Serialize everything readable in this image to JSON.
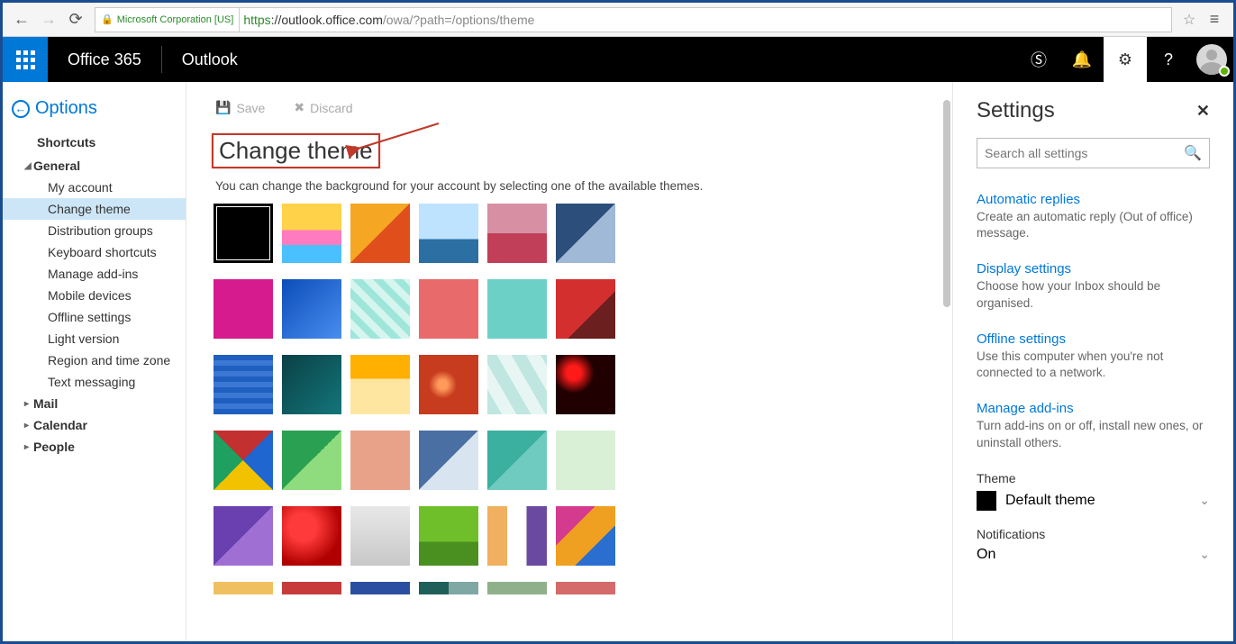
{
  "browser": {
    "cert_name": "Microsoft Corporation [US]",
    "url_proto": "https",
    "url_host": "://outlook.office.com",
    "url_path": "/owa/?path=/options/theme"
  },
  "suite": {
    "brand": "Office 365",
    "app": "Outlook"
  },
  "options": {
    "back_label": "Options",
    "shortcuts_label": "Shortcuts",
    "sections": {
      "general": "General",
      "mail": "Mail",
      "calendar": "Calendar",
      "people": "People"
    },
    "general_items": [
      "My account",
      "Change theme",
      "Distribution groups",
      "Keyboard shortcuts",
      "Manage add-ins",
      "Mobile devices",
      "Offline settings",
      "Light version",
      "Region and time zone",
      "Text messaging"
    ]
  },
  "toolbar": {
    "save": "Save",
    "discard": "Discard"
  },
  "page": {
    "title": "Change theme",
    "desc": "You can change the background for your account by selecting one of the available themes."
  },
  "settings": {
    "title": "Settings",
    "search_placeholder": "Search all settings",
    "items": [
      {
        "title": "Automatic replies",
        "desc": "Create an automatic reply (Out of office) message."
      },
      {
        "title": "Display settings",
        "desc": "Choose how your Inbox should be organised."
      },
      {
        "title": "Offline settings",
        "desc": "Use this computer when you're not connected to a network."
      },
      {
        "title": "Manage add-ins",
        "desc": "Turn add-ins on or off, install new ones, or uninstall others."
      }
    ],
    "theme_label": "Theme",
    "theme_value": "Default theme",
    "notifications_label": "Notifications",
    "notifications_value": "On"
  },
  "themes": [
    {
      "name": "default-black",
      "bg": "#000000",
      "selected": true
    },
    {
      "name": "balloons",
      "bg": "linear-gradient(180deg,#ffd24a 0 45%,#ff7bbf 45% 70%,#4ac0ff 70% 100%)"
    },
    {
      "name": "lego",
      "bg": "linear-gradient(135deg,#f5a623 0 50%,#e04e1b 50% 100%)"
    },
    {
      "name": "sailboat",
      "bg": "linear-gradient(180deg,#bde3ff 0 60%,#2b6fa3 60% 100%)"
    },
    {
      "name": "palm-sunset",
      "bg": "linear-gradient(180deg,#d68fa3 0 50%,#c23f59 50% 100%)"
    },
    {
      "name": "wave",
      "bg": "linear-gradient(135deg,#2b4f7a 0 50%,#9fb9d6 50% 100%)"
    },
    {
      "name": "magenta",
      "bg": "#d61b8e"
    },
    {
      "name": "blue-crystal",
      "bg": "linear-gradient(135deg,#0b4db8 0%,#4a8df0 100%)"
    },
    {
      "name": "chevron",
      "bg": "repeating-linear-gradient(45deg,#9fe6da 0 8px,#d6f5ef 8px 16px)"
    },
    {
      "name": "coral",
      "bg": "#e86a6a"
    },
    {
      "name": "robot",
      "bg": "linear-gradient(180deg,#6dd0c7 0 100%)"
    },
    {
      "name": "red-fold",
      "bg": "linear-gradient(135deg,#d32f2f 0 60%,#6b1f1f 60% 100%)"
    },
    {
      "name": "blueprint",
      "bg": "repeating-linear-gradient(0deg,#1f5fbf 0 6px,#3a78d4 6px 12px)"
    },
    {
      "name": "circuit",
      "bg": "linear-gradient(135deg,#0a4045 0%,#13767a 100%)"
    },
    {
      "name": "crayons",
      "bg": "linear-gradient(180deg,#ffb000 0 40%,#ffe6a0 40% 100%)"
    },
    {
      "name": "bokeh",
      "bg": "radial-gradient(circle at 40% 50%,#ff9a5a 0 10%,#c73c1f 30% 100%)"
    },
    {
      "name": "hex-teal",
      "bg": "repeating-linear-gradient(60deg,#bfe6e0 0 14px,#e8f6f3 14px 28px)"
    },
    {
      "name": "dots-red",
      "bg": "radial-gradient(circle at 30% 30%,#ff1a1a 0 12%,#200000 35% 100%)"
    },
    {
      "name": "triangles",
      "bg": "conic-gradient(from 45deg,#1f66d1 0 25%,#f2c200 25% 50%,#1fa060 50% 75%,#c23030 75% 100%)"
    },
    {
      "name": "abstract-green",
      "bg": "linear-gradient(135deg,#2aa052 0 50%,#8fdc7f 50% 100%)"
    },
    {
      "name": "salmon",
      "bg": "#e8a28a"
    },
    {
      "name": "fabric",
      "bg": "linear-gradient(135deg,#4a6fa3 0 50%,#d8e4f0 50% 100%)"
    },
    {
      "name": "poly-teal",
      "bg": "linear-gradient(135deg,#3bb0a0 0 50%,#6fcabf 50% 100%)"
    },
    {
      "name": "mint",
      "bg": "#d9f0d6"
    },
    {
      "name": "purple-fold",
      "bg": "linear-gradient(135deg,#6a3fb0 0 50%,#a06fd4 50% 100%)"
    },
    {
      "name": "strawberry",
      "bg": "radial-gradient(circle at 35% 35%,#ff3a3a 0 25%,#b00000 70% 100%)"
    },
    {
      "name": "snowflakes",
      "bg": "linear-gradient(180deg,#e8e8e8 0%,#c8c8c8 100%)"
    },
    {
      "name": "green-field",
      "bg": "linear-gradient(180deg,#6fbf2a 0 60%,#4a9020 60% 100%)"
    },
    {
      "name": "stripes",
      "bg": "linear-gradient(90deg,#f0b060 0 33%,#ffffff 33% 66%,#6a4aa0 66% 100%)"
    },
    {
      "name": "paint-splash",
      "bg": "linear-gradient(135deg,#d43a8e 0 33%,#f0a020 33% 66%,#2a6fd0 66% 100%)"
    },
    {
      "name": "peek1",
      "bg": "#f0c060"
    },
    {
      "name": "peek2",
      "bg": "#c83a3a"
    },
    {
      "name": "peek3",
      "bg": "#2a4fa0"
    },
    {
      "name": "peek4",
      "bg": "linear-gradient(90deg,#1f5f5a 0 50%,#7fa8a4 50% 100%)"
    },
    {
      "name": "peek5",
      "bg": "#8fb08a"
    },
    {
      "name": "peek6",
      "bg": "#d46a6a"
    }
  ]
}
